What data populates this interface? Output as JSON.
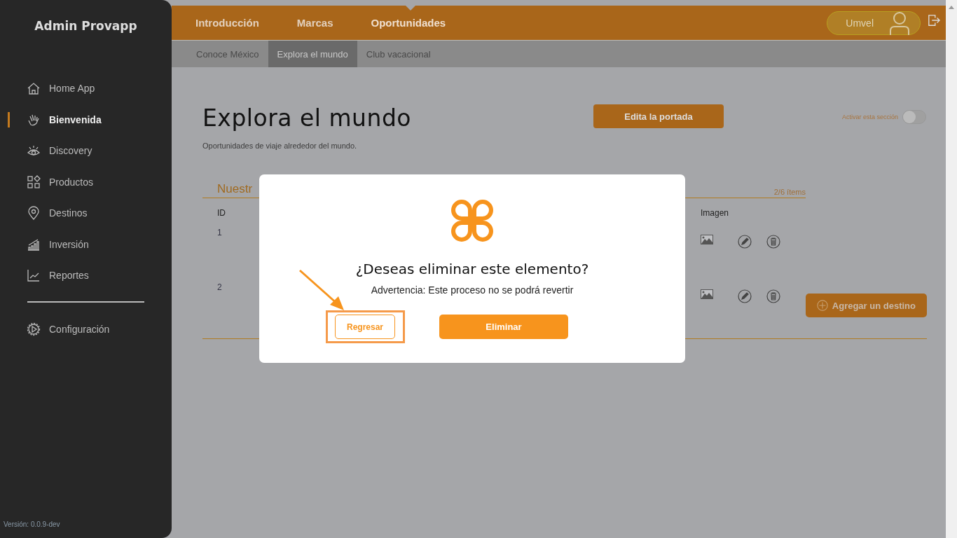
{
  "sidebar": {
    "title": "Admin Provapp",
    "items": [
      {
        "label": "Home App",
        "selected": false
      },
      {
        "label": "Bienvenida",
        "selected": true
      },
      {
        "label": "Discovery",
        "selected": false
      },
      {
        "label": "Productos",
        "selected": false
      },
      {
        "label": "Destinos",
        "selected": false
      },
      {
        "label": "Inversión",
        "selected": false
      },
      {
        "label": "Reportes",
        "selected": false
      }
    ],
    "footer_items": [
      {
        "label": "Configuración",
        "selected": false
      }
    ],
    "version": "Versión: 0.0.9-dev"
  },
  "top_tabs": [
    {
      "label": "Introducción",
      "selected": false
    },
    {
      "label": "Marcas",
      "selected": false
    },
    {
      "label": "Oportunidades",
      "selected": true
    }
  ],
  "user": {
    "name": "Umvel"
  },
  "sub_tabs": [
    {
      "label": "Conoce México",
      "selected": false
    },
    {
      "label": "Explora el mundo",
      "selected": true
    },
    {
      "label": "Club vacacional",
      "selected": false
    }
  ],
  "page": {
    "title": "Explora el mundo",
    "subtitle": "Oportunidades de viaje alrededor del mundo.",
    "edit_button": "Edita la portada",
    "toggle": {
      "label": "Activar esta sección",
      "on": false
    }
  },
  "table": {
    "heading": "Nuestr",
    "count": "2/6 ítems",
    "columns": [
      {
        "label": "ID"
      },
      {
        "label": "Imagen"
      }
    ],
    "rows": [
      {
        "id": "1"
      },
      {
        "id": "2"
      }
    ],
    "add_button": "Agregar un destino"
  },
  "dialog": {
    "title": "¿Deseas eliminar este elemento?",
    "message": "Advertencia: Este proceso no se podrá revertir",
    "cancel": "Regresar",
    "confirm": "Eliminar"
  }
}
